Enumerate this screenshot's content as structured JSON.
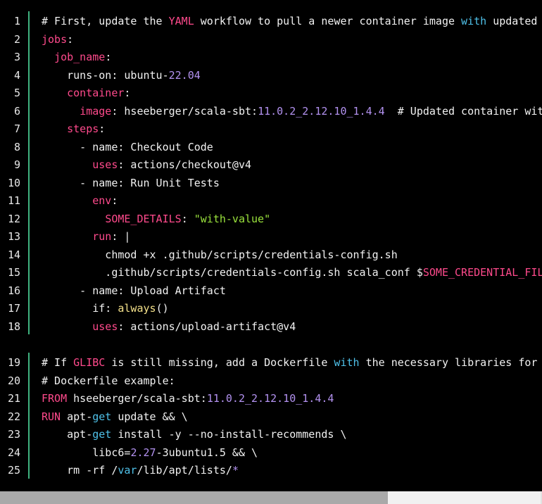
{
  "colors": {
    "default": "#f2f2f2",
    "key": "#ff4a8c",
    "number": "#b392f0",
    "string": "#9ae23c",
    "builtin": "#4fc1e9",
    "func": "#f3e08a",
    "gutter_bar": "#3fb27f",
    "line_number": "#e8e8e8",
    "background": "#000000"
  },
  "blocks": [
    {
      "lines": [
        {
          "n": "1",
          "tokens": [
            {
              "t": "# First, update the ",
              "c": "default"
            },
            {
              "t": "YAML",
              "c": "key"
            },
            {
              "t": " workflow to pull a newer container image ",
              "c": "default"
            },
            {
              "t": "with",
              "c": "builtin"
            },
            {
              "t": " updated",
              "c": "default"
            }
          ]
        },
        {
          "n": "2",
          "tokens": [
            {
              "t": "jobs",
              "c": "key"
            },
            {
              "t": ":",
              "c": "default"
            }
          ]
        },
        {
          "n": "3",
          "tokens": [
            {
              "t": "  ",
              "c": "default"
            },
            {
              "t": "job_name",
              "c": "key"
            },
            {
              "t": ":",
              "c": "default"
            }
          ]
        },
        {
          "n": "4",
          "tokens": [
            {
              "t": "    runs-on: ubuntu-",
              "c": "default"
            },
            {
              "t": "22.04",
              "c": "number"
            }
          ]
        },
        {
          "n": "5",
          "tokens": [
            {
              "t": "    ",
              "c": "default"
            },
            {
              "t": "container",
              "c": "key"
            },
            {
              "t": ":",
              "c": "default"
            }
          ]
        },
        {
          "n": "6",
          "tokens": [
            {
              "t": "      ",
              "c": "default"
            },
            {
              "t": "image",
              "c": "key"
            },
            {
              "t": ": hseeberger/scala-sbt:",
              "c": "default"
            },
            {
              "t": "11.0.2_2.12.10_1.4.4",
              "c": "number"
            },
            {
              "t": "  # Updated container with",
              "c": "default"
            }
          ]
        },
        {
          "n": "7",
          "tokens": [
            {
              "t": "    ",
              "c": "default"
            },
            {
              "t": "steps",
              "c": "key"
            },
            {
              "t": ":",
              "c": "default"
            }
          ]
        },
        {
          "n": "8",
          "tokens": [
            {
              "t": "      - name: Checkout Code",
              "c": "default"
            }
          ]
        },
        {
          "n": "9",
          "tokens": [
            {
              "t": "        ",
              "c": "default"
            },
            {
              "t": "uses",
              "c": "key"
            },
            {
              "t": ": actions/checkout@v4",
              "c": "default"
            }
          ]
        },
        {
          "n": "10",
          "tokens": [
            {
              "t": "      - name: Run Unit Tests",
              "c": "default"
            }
          ]
        },
        {
          "n": "11",
          "tokens": [
            {
              "t": "        ",
              "c": "default"
            },
            {
              "t": "env",
              "c": "key"
            },
            {
              "t": ":",
              "c": "default"
            }
          ]
        },
        {
          "n": "12",
          "tokens": [
            {
              "t": "          ",
              "c": "default"
            },
            {
              "t": "SOME_DETAILS",
              "c": "key"
            },
            {
              "t": ": ",
              "c": "default"
            },
            {
              "t": "\"with-value\"",
              "c": "string"
            }
          ]
        },
        {
          "n": "13",
          "tokens": [
            {
              "t": "        ",
              "c": "default"
            },
            {
              "t": "run",
              "c": "key"
            },
            {
              "t": ": |",
              "c": "default"
            }
          ]
        },
        {
          "n": "14",
          "tokens": [
            {
              "t": "          chmod +x .github/scripts/credentials-config.sh",
              "c": "default"
            }
          ]
        },
        {
          "n": "15",
          "tokens": [
            {
              "t": "          .github/scripts/credentials-config.sh scala_conf $",
              "c": "default"
            },
            {
              "t": "SOME_CREDENTIAL_FILE",
              "c": "key"
            }
          ]
        },
        {
          "n": "16",
          "tokens": [
            {
              "t": "      - name: Upload Artifact",
              "c": "default"
            }
          ]
        },
        {
          "n": "17",
          "tokens": [
            {
              "t": "        if: ",
              "c": "default"
            },
            {
              "t": "always",
              "c": "func"
            },
            {
              "t": "()",
              "c": "default"
            }
          ]
        },
        {
          "n": "18",
          "tokens": [
            {
              "t": "        ",
              "c": "default"
            },
            {
              "t": "uses",
              "c": "key"
            },
            {
              "t": ": actions/upload-artifact@v4",
              "c": "default"
            }
          ]
        }
      ]
    },
    {
      "lines": [
        {
          "n": "19",
          "tokens": [
            {
              "t": "# If ",
              "c": "default"
            },
            {
              "t": "GLIBC",
              "c": "key"
            },
            {
              "t": " is still missing, add a Dockerfile ",
              "c": "default"
            },
            {
              "t": "with",
              "c": "builtin"
            },
            {
              "t": " the necessary libraries for",
              "c": "default"
            }
          ]
        },
        {
          "n": "20",
          "tokens": [
            {
              "t": "# Dockerfile example:",
              "c": "default"
            }
          ]
        },
        {
          "n": "21",
          "tokens": [
            {
              "t": "FROM",
              "c": "key"
            },
            {
              "t": " hseeberger/scala-sbt:",
              "c": "default"
            },
            {
              "t": "11.0.2_2.12.10_1.4.4",
              "c": "number"
            }
          ]
        },
        {
          "n": "22",
          "tokens": [
            {
              "t": "RUN",
              "c": "key"
            },
            {
              "t": " apt-",
              "c": "default"
            },
            {
              "t": "get",
              "c": "builtin"
            },
            {
              "t": " update && \\",
              "c": "default"
            }
          ]
        },
        {
          "n": "23",
          "tokens": [
            {
              "t": "    apt-",
              "c": "default"
            },
            {
              "t": "get",
              "c": "builtin"
            },
            {
              "t": " install -y --no-install-recommends \\",
              "c": "default"
            }
          ]
        },
        {
          "n": "24",
          "tokens": [
            {
              "t": "        libc6=",
              "c": "default"
            },
            {
              "t": "2.27",
              "c": "number"
            },
            {
              "t": "-3ubuntu1.5 && \\",
              "c": "default"
            }
          ]
        },
        {
          "n": "25",
          "tokens": [
            {
              "t": "    rm -rf /",
              "c": "default"
            },
            {
              "t": "var",
              "c": "builtin"
            },
            {
              "t": "/lib/apt/lists/",
              "c": "default"
            },
            {
              "t": "*",
              "c": "number"
            }
          ]
        }
      ]
    }
  ],
  "scrollbar": {
    "thumb_fraction": 0.716,
    "position_fraction": 0
  }
}
